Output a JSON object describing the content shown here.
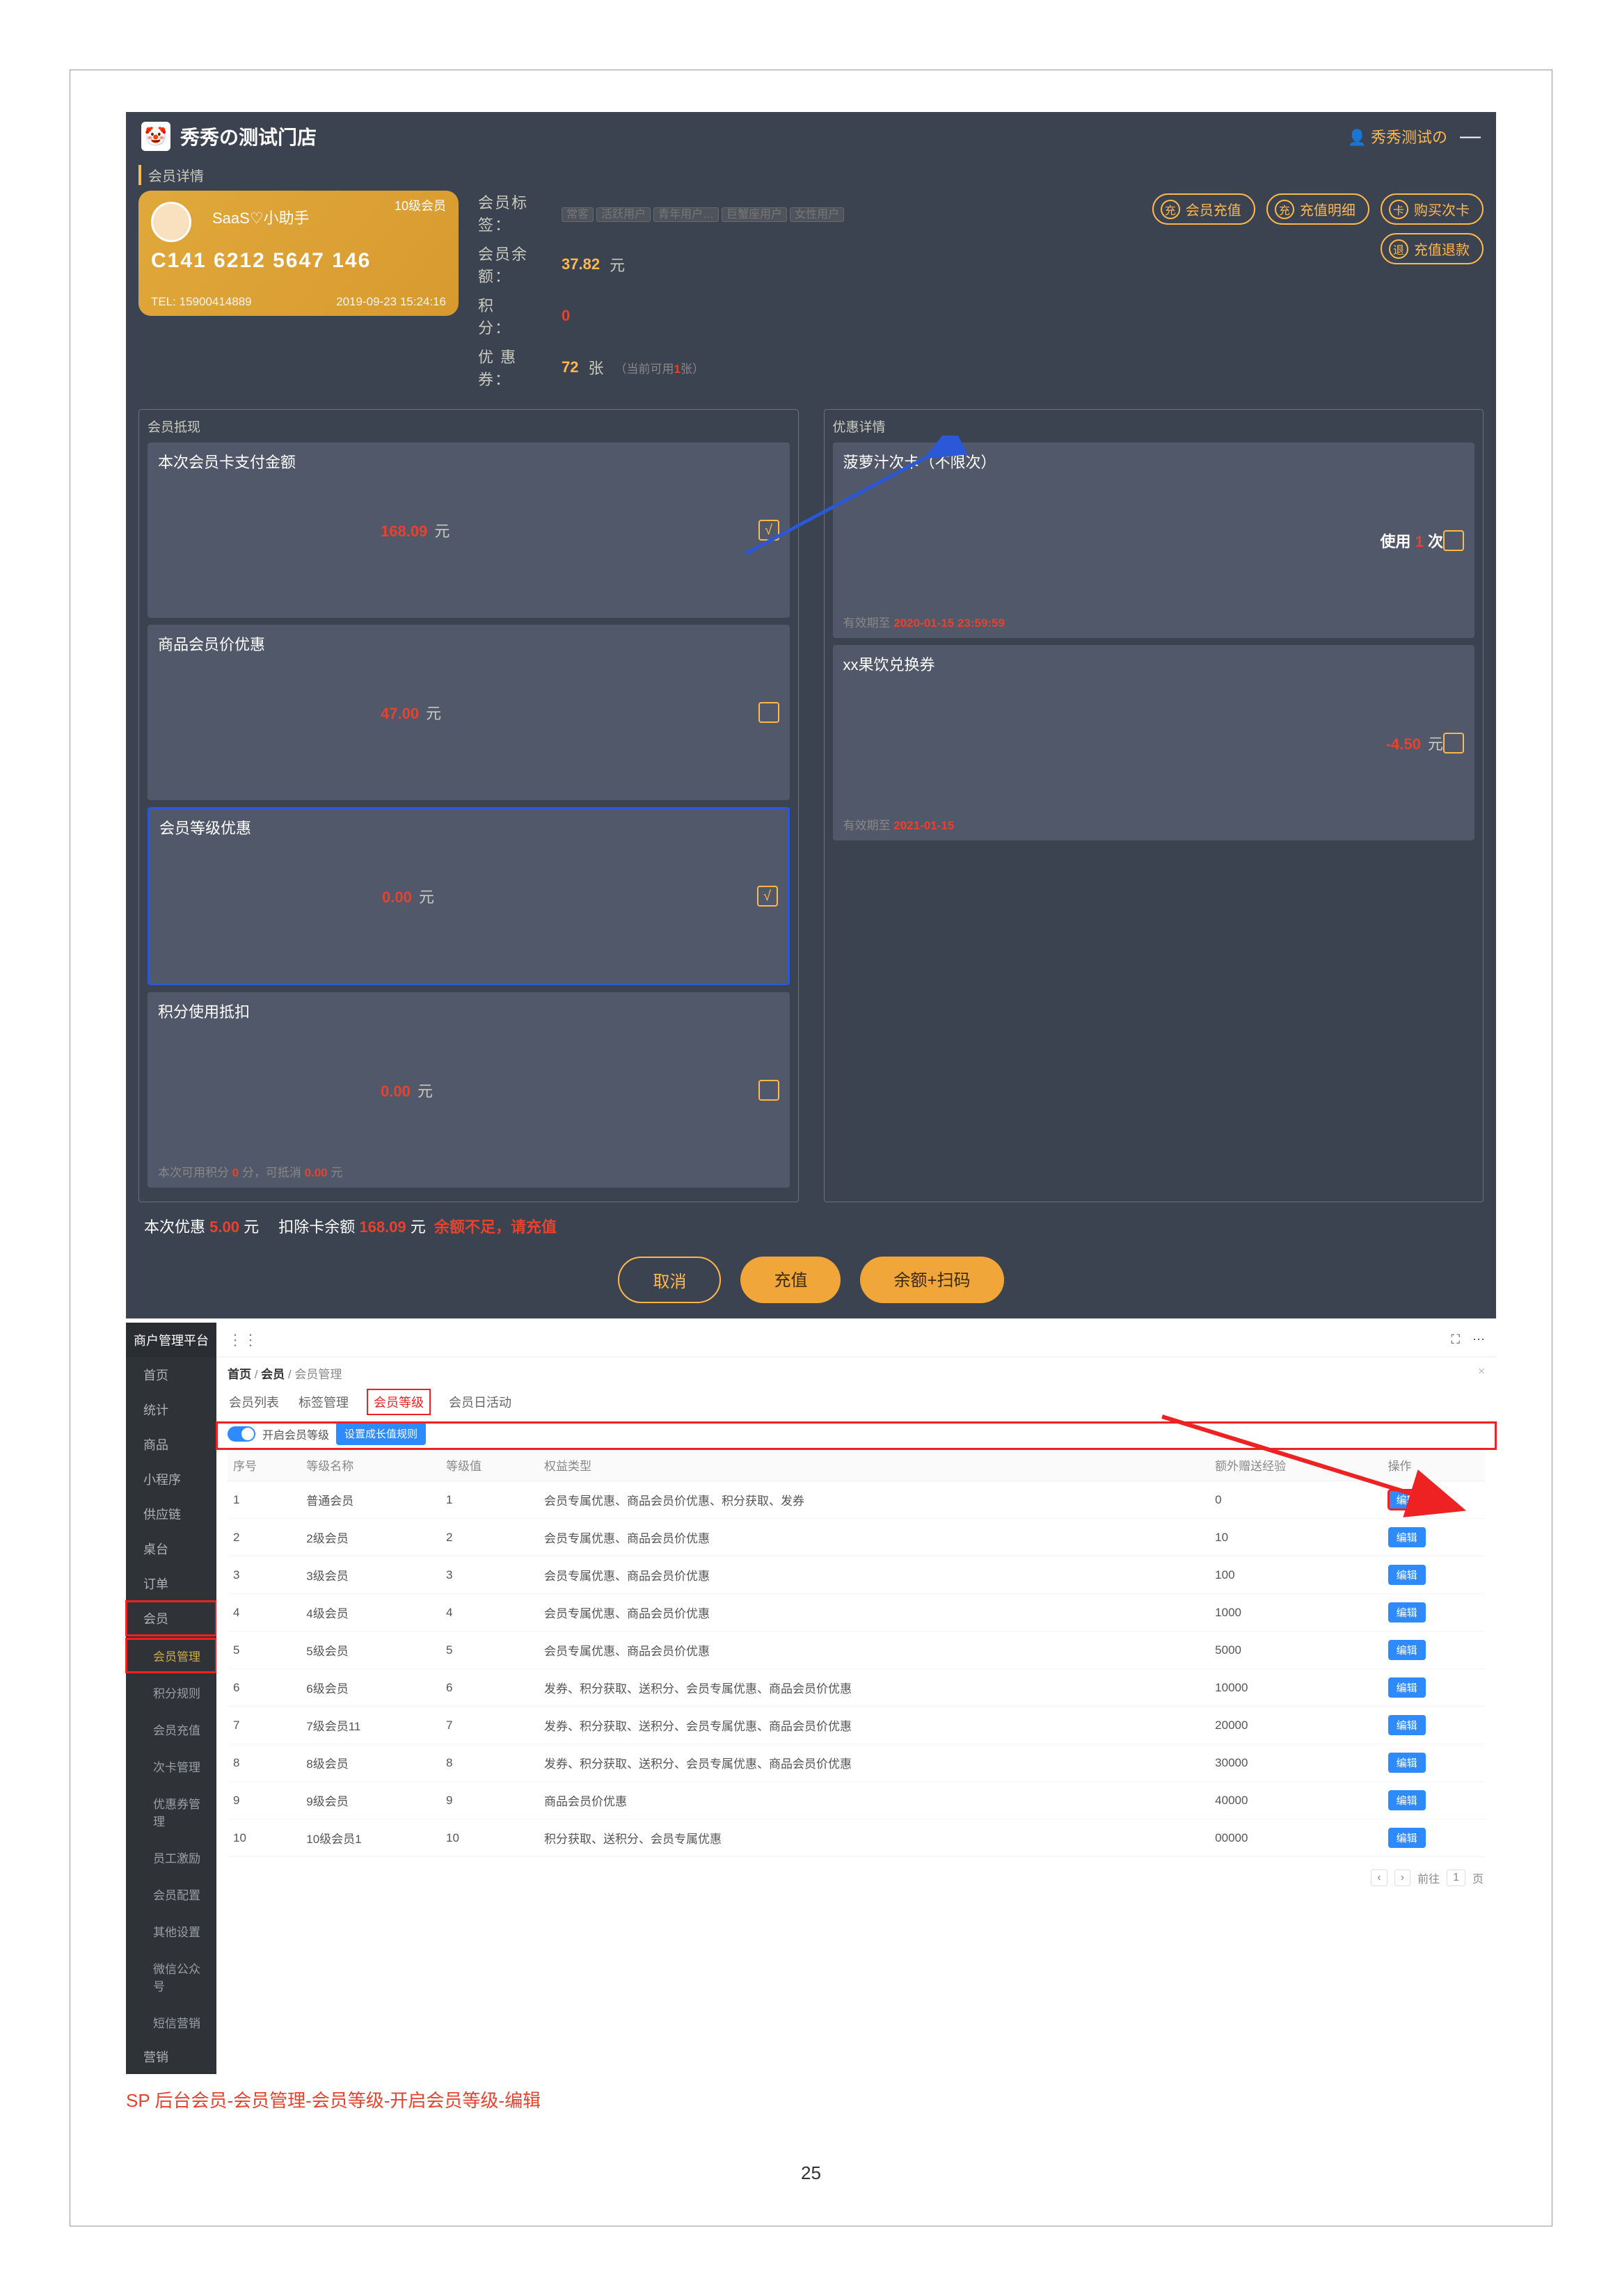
{
  "page_number": "25",
  "caption": "SP 后台会员-会员管理-会员等级-开启会员等级-编辑",
  "pos": {
    "store_name": "秀秀の测试门店",
    "operator_label": "秀秀测试の",
    "section_member_detail": "会员详情",
    "card": {
      "level": "10级会员",
      "name_prefix_mask": "",
      "name": "SaaS♡小助手",
      "card_no": "C141 6212 5647 146",
      "tel_label": "TEL: 15900414889",
      "time": "2019-09-23 15:24:16"
    },
    "info": {
      "tags_label": "会员标签：",
      "tags": [
        "常客",
        "活跃用户",
        "青年用户…",
        "巨蟹座用户",
        "女性用户"
      ],
      "balance_label": "会员余额：",
      "balance_value": "37.82",
      "balance_unit": "元",
      "points_label": "积　　分：",
      "points_value": "0",
      "coupons_label": "优 惠 券：",
      "coupons_value": "72",
      "coupons_unit": "张",
      "coupons_hint_a": "（当前可用",
      "coupons_hint_b": "1",
      "coupons_hint_c": "张）"
    },
    "actions": {
      "recharge": {
        "icon": "充",
        "label": "会员充值"
      },
      "recharge_log": {
        "icon": "充",
        "label": "充值明细"
      },
      "buy_card": {
        "icon": "卡",
        "label": "购买次卡"
      },
      "refund": {
        "icon": "退",
        "label": "充值退款"
      }
    },
    "left_panel": {
      "title": "会员抵现",
      "rows": [
        {
          "label": "本次会员卡支付金额",
          "value": "168.09",
          "unit": "元",
          "chk": true,
          "sub": ""
        },
        {
          "label": "商品会员价优惠",
          "value": "47.00",
          "unit": "元",
          "chk": false,
          "sub": ""
        },
        {
          "label": "会员等级优惠",
          "value": "0.00",
          "unit": "元",
          "chk": true,
          "sub": "",
          "hl": true
        },
        {
          "label": "积分使用抵扣",
          "value": "0.00",
          "unit": "元",
          "chk": false,
          "sub": "本次可用积分 0 分，可抵消 0.00 元"
        }
      ],
      "sub_parts": {
        "p0": "本次可用积分",
        "p1": "0",
        "p2": "分，可抵消",
        "p3": "0.00",
        "p4": "元"
      }
    },
    "right_panel": {
      "title": "优惠详情",
      "rows": [
        {
          "label": "菠萝汁次卡（不限次）",
          "mid": "使用",
          "mid_red": "1",
          "mid_tail": "次",
          "sub": "有效期至 ",
          "sub_red": "2020-01-15 23:59:59",
          "chk": false
        },
        {
          "label": "xx果饮兑换券",
          "value": "-4.50",
          "unit": "元",
          "sub": "有效期至 ",
          "sub_red": "2021-01-15",
          "chk": false
        }
      ]
    },
    "totals": {
      "prefix": "本次优惠",
      "disc": "5.00",
      "unit1": "元",
      "sep": "　扣除卡余额",
      "deduct": "168.09",
      "unit2": "元",
      "warn": "余额不足，请充值"
    },
    "btns": {
      "cancel": "取消",
      "recharge": "充值",
      "scan": "余额+扫码"
    }
  },
  "admin": {
    "brand": "商户管理平台",
    "side": [
      {
        "t": "首页"
      },
      {
        "t": "统计"
      },
      {
        "t": "商品"
      },
      {
        "t": "小程序"
      },
      {
        "t": "供应链"
      },
      {
        "t": "桌台"
      },
      {
        "t": "订单"
      },
      {
        "t": "会员",
        "red": true
      },
      {
        "t": "会员管理",
        "sub": true,
        "active": true,
        "red": true
      },
      {
        "t": "积分规则",
        "sub": true
      },
      {
        "t": "会员充值",
        "sub": true
      },
      {
        "t": "次卡管理",
        "sub": true
      },
      {
        "t": "优惠券管理",
        "sub": true
      },
      {
        "t": "员工激励",
        "sub": true
      },
      {
        "t": "会员配置",
        "sub": true
      },
      {
        "t": "其他设置",
        "sub": true
      },
      {
        "t": "微信公众号",
        "sub": true
      },
      {
        "t": "短信营销",
        "sub": true
      },
      {
        "t": "营销"
      }
    ],
    "crumb_a": "首页",
    "crumb_b": "会员",
    "crumb_c": "会员管理",
    "tabs": [
      "会员列表",
      "标签管理",
      "会员等级",
      "会员日活动"
    ],
    "tab_redbox_index": 2,
    "toolbar": {
      "toggle_label": "开启会员等级",
      "save_btn": "设置成长值规则"
    },
    "toolbar_redbox": true,
    "thead": [
      "序号",
      "等级名称",
      "等级值",
      "权益类型",
      "额外赠送经验",
      "操作"
    ],
    "rows": [
      {
        "no": "1",
        "name": "普通会员",
        "v": "1",
        "rights": "会员专属优惠、商品会员价优惠、积分获取、发券",
        "exp": "0"
      },
      {
        "no": "2",
        "name": "2级会员",
        "v": "2",
        "rights": "会员专属优惠、商品会员价优惠",
        "exp": "10"
      },
      {
        "no": "3",
        "name": "3级会员",
        "v": "3",
        "rights": "会员专属优惠、商品会员价优惠",
        "exp": "100"
      },
      {
        "no": "4",
        "name": "4级会员",
        "v": "4",
        "rights": "会员专属优惠、商品会员价优惠",
        "exp": "1000"
      },
      {
        "no": "5",
        "name": "5级会员",
        "v": "5",
        "rights": "会员专属优惠、商品会员价优惠",
        "exp": "5000"
      },
      {
        "no": "6",
        "name": "6级会员",
        "v": "6",
        "rights": "发券、积分获取、送积分、会员专属优惠、商品会员价优惠",
        "exp": "10000"
      },
      {
        "no": "7",
        "name": "7级会员11",
        "v": "7",
        "rights": "发券、积分获取、送积分、会员专属优惠、商品会员价优惠",
        "exp": "20000"
      },
      {
        "no": "8",
        "name": "8级会员",
        "v": "8",
        "rights": "发券、积分获取、送积分、会员专属优惠、商品会员价优惠",
        "exp": "30000"
      },
      {
        "no": "9",
        "name": "9级会员",
        "v": "9",
        "rights": "商品会员价优惠",
        "exp": "40000"
      },
      {
        "no": "10",
        "name": "10级会员1",
        "v": "10",
        "rights": "积分获取、送积分、会员专属优惠",
        "exp": "00000"
      }
    ],
    "edit_label": "编辑",
    "pager": {
      "prev": "‹",
      "next": "›",
      "goto": "前往",
      "page": "1",
      "unit": "页"
    }
  }
}
